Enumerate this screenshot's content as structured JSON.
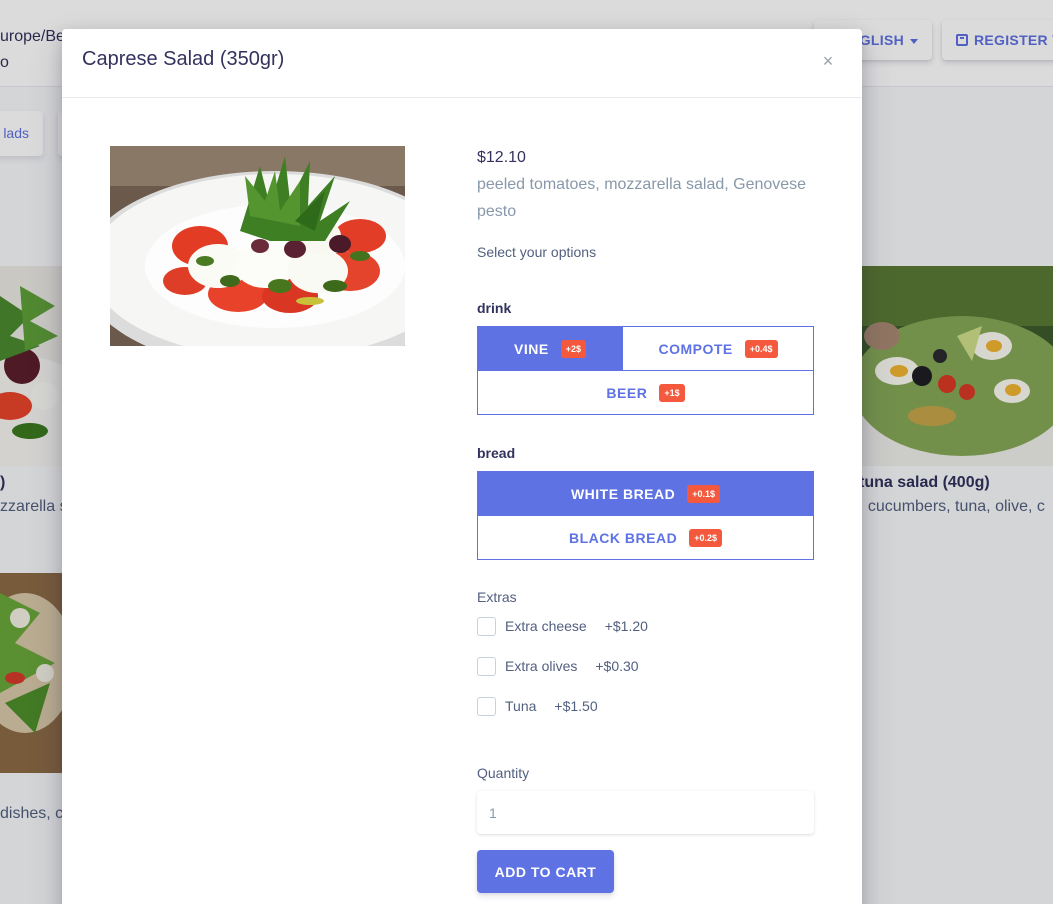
{
  "background": {
    "timezone_line1": "urope/Ber",
    "timezone_line2": "o",
    "language_label": "GLISH",
    "register_label": "REGISTER V",
    "category_label": "lads",
    "left_card": {
      "title": ")",
      "description": "zzarella s"
    },
    "left_card_2": {
      "description": "dishes, c"
    },
    "right_card": {
      "title": "tuna salad (400g)",
      "description": ", cucumbers, tuna, olive, c"
    }
  },
  "modal": {
    "title": "Caprese Salad (350gr)",
    "close_label": "×",
    "image_alt": "Caprese salad with tomatoes, mozzarella, arugula and pesto",
    "price": "$12.10",
    "description": "peeled tomatoes, mozzarella salad, Genovese pesto",
    "select_options_label": "Select your options",
    "option_groups": [
      {
        "name": "drink",
        "options": [
          {
            "label": "VINE",
            "badge": "+2$",
            "selected": true
          },
          {
            "label": "COMPOTE",
            "badge": "+0.4$",
            "selected": false
          },
          {
            "label": "BEER",
            "badge": "+1$",
            "selected": false
          }
        ]
      },
      {
        "name": "bread",
        "options": [
          {
            "label": "WHITE BREAD",
            "badge": "+0.1$",
            "selected": true
          },
          {
            "label": "BLACK BREAD",
            "badge": "+0.2$",
            "selected": false
          }
        ]
      }
    ],
    "extras_label": "Extras",
    "extras": [
      {
        "name": "Extra cheese",
        "price": "+$1.20",
        "checked": false
      },
      {
        "name": "Extra olives",
        "price": "+$0.30",
        "checked": false
      },
      {
        "name": "Tuna",
        "price": "+$1.50",
        "checked": false
      }
    ],
    "quantity_label": "Quantity",
    "quantity_value": "1",
    "add_to_cart_label": "ADD TO CART"
  },
  "colors": {
    "primary": "#5e72e4",
    "badge": "#f5593d",
    "heading": "#32325d",
    "text": "#525f7f",
    "muted": "#8898aa"
  }
}
